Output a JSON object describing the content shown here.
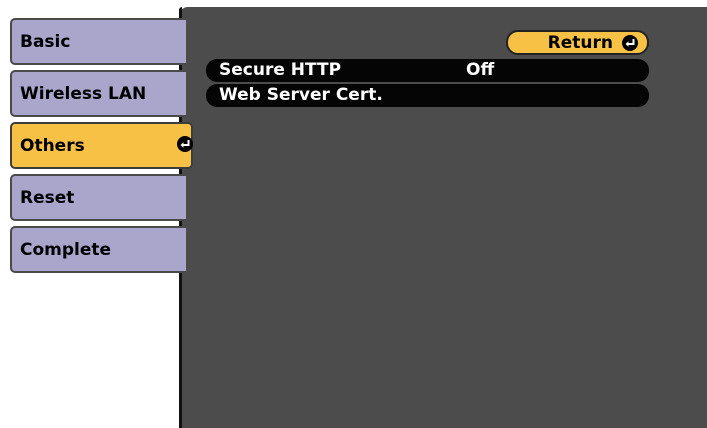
{
  "sidebar": {
    "tabs": [
      {
        "label": "Basic",
        "state": "inactive"
      },
      {
        "label": "Wireless LAN",
        "state": "inactive"
      },
      {
        "label": "Others",
        "state": "active"
      },
      {
        "label": "Reset",
        "state": "inactive"
      },
      {
        "label": "Complete",
        "state": "inactive"
      }
    ],
    "active_icon": "enter-icon"
  },
  "panel": {
    "return_button": {
      "label": "Return",
      "icon": "enter-icon"
    },
    "settings": [
      {
        "label": "Secure HTTP",
        "value": "Off"
      },
      {
        "label": "Web Server Cert.",
        "value": ""
      }
    ]
  },
  "colors": {
    "highlight": "#f7c145",
    "tab_inactive": "#a9a5cb",
    "panel_background": "#4c4c4c",
    "row_background": "#050505"
  }
}
